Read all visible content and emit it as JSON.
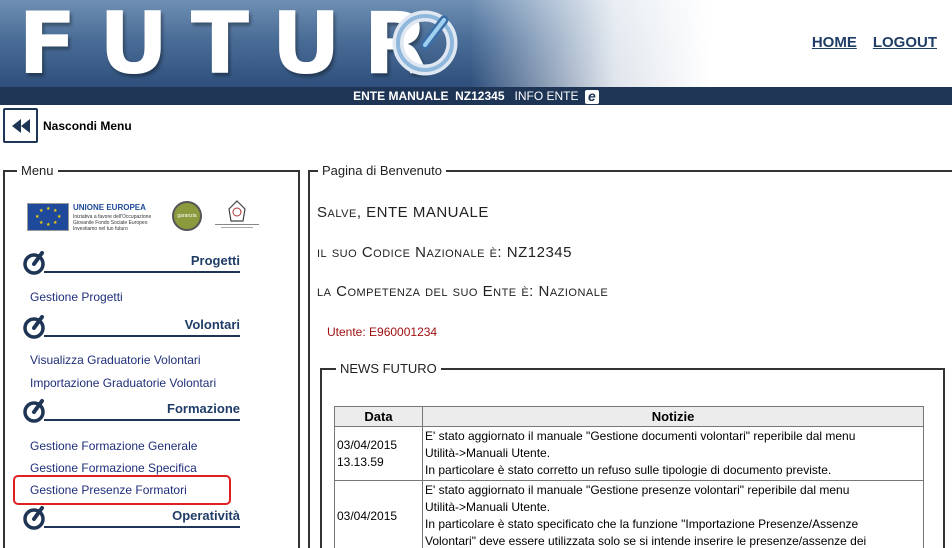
{
  "header": {
    "logo_text": "FUTUR",
    "home_label": "HOME",
    "logout_label": "LOGOUT"
  },
  "ente_bar": {
    "ente_name": "ENTE MANUALE",
    "ente_code": "NZ12345",
    "info_label": "INFO ENTE",
    "info_icon": "e"
  },
  "hide_menu": {
    "label": "Nascondi Menu",
    "icon": "double-chevron-left-icon"
  },
  "menu": {
    "legend": "Menu",
    "logos": {
      "eu_title": "UNIONE EUROPEA",
      "eu_subtitle": "Iniziativa a favore dell'Occupazione Giovanile Fondo Sociale Europeo Investiamo nel tuo futuro",
      "gy_label": "garanzia giovani"
    },
    "sections": [
      {
        "title": "Progetti",
        "items": [
          "Gestione Progetti"
        ]
      },
      {
        "title": "Volontari",
        "items": [
          "Visualizza Graduatorie Volontari",
          "Importazione Graduatorie Volontari"
        ]
      },
      {
        "title": "Formazione",
        "items": [
          "Gestione Formazione Generale",
          "Gestione Formazione Specifica",
          "Gestione Presenze Formatori"
        ]
      },
      {
        "title": "Operatività",
        "items": []
      }
    ]
  },
  "main": {
    "legend": "Pagina di Benvenuto",
    "greeting": "Salve, ENTE MANUALE",
    "codice": "il suo Codice Nazionale è: NZ12345",
    "competenza": "la Competenza del suo Ente è: Nazionale",
    "utente": "Utente: E960001234",
    "news": {
      "legend": "NEWS FUTURO",
      "headers": [
        "Data",
        "Notizie"
      ],
      "rows": [
        {
          "date": "03/04/2015 13.13.59",
          "lines": [
            "E' stato aggiornato il manuale \"Gestione documenti volontari\" reperibile dal menu",
            "Utilità->Manuali Utente.",
            "In particolare è stato corretto un refuso sulle tipologie di documento previste."
          ]
        },
        {
          "date": "03/04/2015",
          "lines": [
            "E' stato aggiornato il manuale \"Gestione presenze volontari\" reperibile dal menu",
            "Utilità->Manuali Utente.",
            "In particolare è stato specificato che la funzione \"Importazione Presenze/Assenze",
            "Volontari\" deve essere utilizzata solo se si intende inserire le presenze/assenze dei"
          ]
        }
      ]
    }
  }
}
